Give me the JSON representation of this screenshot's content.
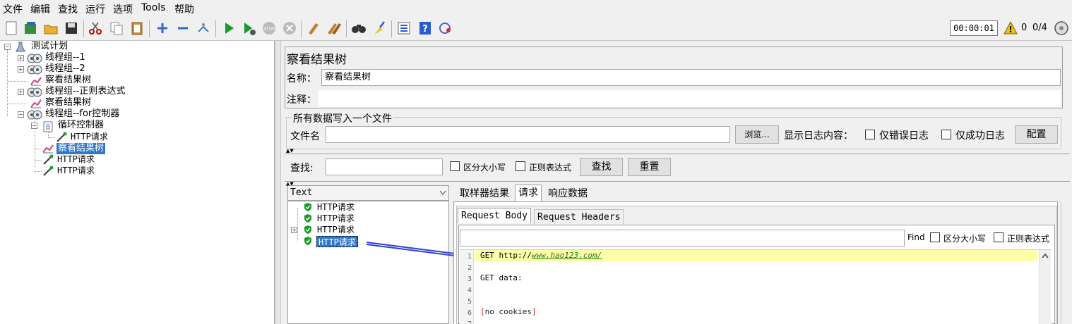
{
  "menu": [
    "文件",
    "编辑",
    "查找",
    "运行",
    "选项",
    "Tools",
    "帮助"
  ],
  "toolbar": {
    "timer": "00:00:01",
    "warn_count": "0",
    "threads": "0/4"
  },
  "tree": {
    "root": "测试计划",
    "items": [
      "线程组--1",
      "线程组--2",
      "察看结果树",
      "线程组--正则表达式",
      "察看结果树",
      "线程组--for控制器",
      "循环控制器",
      "HTTP请求",
      "察看结果树",
      "HTTP请求",
      "HTTP请求"
    ]
  },
  "panel": {
    "title": "察看结果树",
    "name_label": "名称：",
    "name_value": "察看结果树",
    "comment_label": "注释：",
    "file_section": "所有数据写入一个文件",
    "filename_label": "文件名",
    "browse_button": "浏览...",
    "log_content_label": "显示日志内容：",
    "errors_only": "仅错误日志",
    "success_only": "仅成功日志",
    "configure_button": "配置"
  },
  "search": {
    "label": "查找:",
    "case_sensitive": "区分大小写",
    "regex": "正则表达式",
    "find_button": "查找",
    "reset_button": "重置"
  },
  "results": {
    "renderer": "Text",
    "samples": [
      "HTTP请求",
      "HTTP请求",
      "HTTP请求",
      "HTTP请求"
    ],
    "tabs": [
      "取样器结果",
      "请求",
      "响应数据"
    ],
    "subtabs": [
      "Request Body",
      "Request Headers"
    ],
    "find_label": "Find",
    "find_case": "区分大小写",
    "find_regex": "正则表达式"
  },
  "editor": {
    "line1_prefix": "GET http://",
    "line1_url": "www.hao123.com/",
    "line3": "GET data:",
    "line6": "[no cookies]",
    "line_numbers": [
      "1",
      "2",
      "3",
      "4",
      "5",
      "6",
      "7"
    ]
  }
}
